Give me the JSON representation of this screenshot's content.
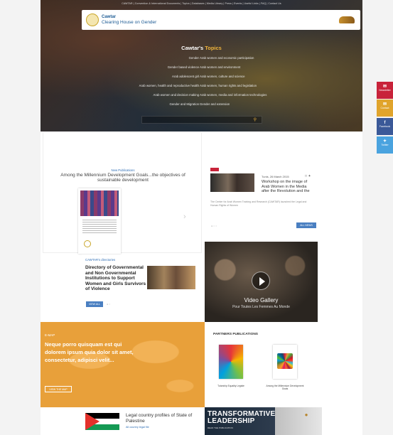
{
  "header": {
    "topbar": "CAWTAR | Convention & International Documents | Topics | Databases | Media Library | Press | Events | Useful Links | FAQ | Contact Us",
    "logo_title": "Cawtar",
    "logo_subtitle": "Clearing House on Gender"
  },
  "topics": {
    "title_main": "Cawtar's",
    "title_accent": "Topics",
    "left": [
      "Gender",
      "Gender based violence",
      "Arab adolescent girl",
      "Arab women, health and reproductive health",
      "Arab women and decision making",
      "Gender and Migration"
    ],
    "right": [
      "Arab women and economic participation",
      "Arab women and environment",
      "Arab women, culture and science",
      "Arab women, human rights and legislation",
      "Arab women, media and information technologies",
      "Gender and extension"
    ]
  },
  "news": {
    "heading": "New Publications",
    "title": "Among the Millennium Development Goals...the objectives of sustainable development"
  },
  "workshop": {
    "date": "Tunis, 26 March 2015",
    "title": "Workshop on the image of Arab Women in the Media after the Revolution and the",
    "desc": "The Center for Arab Women Training and Research (CAWTAR) launched the Legal and Human Rights of Women",
    "more": "ALL NEWS"
  },
  "directories": {
    "heading": "CAWTAR's directories",
    "title": "Directory of Governmental and Non Governmental Institutions to Support Women and Girls Survivors of Violence",
    "button": "VIEW ALL"
  },
  "video": {
    "title": "Video Gallery",
    "subtitle": "Pour Toutes Les Femmes Au Monde"
  },
  "map": {
    "tag": "E-MAP",
    "text": "Neque porro quisquam est qui dolorem ipsum quia dolor sit amet, consectetur, adipisci velit...",
    "button": "VIEW THE MAP"
  },
  "partners": {
    "heading": "PARTNERS PUBLICATIONS",
    "book1": "Tutorship Equality Legiste",
    "book2": "Among the Millennium Development Goals"
  },
  "palestine": {
    "title": "Legal country profiles of State of Palestine",
    "link": "All country legal file"
  },
  "transformative": {
    "title_line1": "TRANSFORMATIVE",
    "title_line2": "LEADERSHIP",
    "subtitle": "READ THE PUBLICATION"
  },
  "social": [
    "Newsletter",
    "Contact",
    "Facebook",
    "Twitter"
  ],
  "colors": {
    "accent": "#f0b43c",
    "link": "#2d6db5",
    "button": "#4a7fc1",
    "map": "#e8a03a",
    "red": "#c8233a"
  }
}
